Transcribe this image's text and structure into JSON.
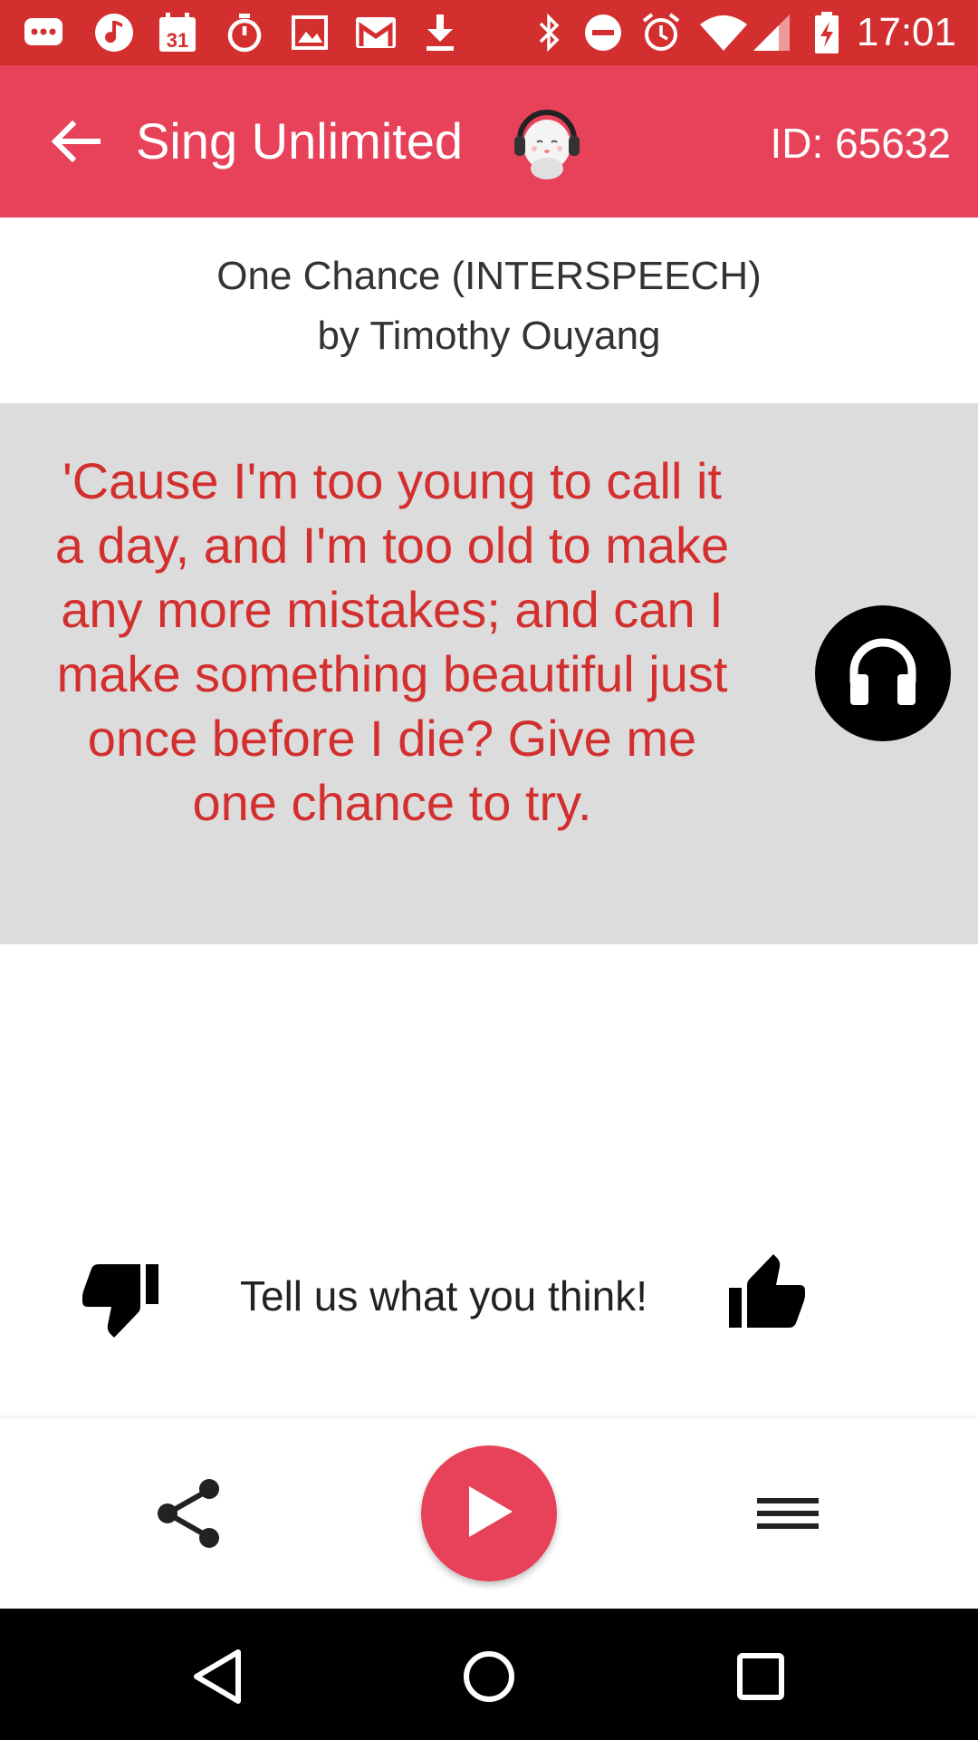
{
  "status_bar": {
    "time": "17:01",
    "calendar_day": "31",
    "icons": [
      "messages-icon",
      "music-note-icon",
      "calendar-icon",
      "stopwatch-icon",
      "image-icon",
      "gmail-icon",
      "download-icon",
      "bluetooth-icon",
      "do-not-disturb-icon",
      "alarm-icon",
      "wifi-icon",
      "signal-icon",
      "battery-charging-icon"
    ]
  },
  "app_bar": {
    "title": "Sing Unlimited",
    "song_id": "ID: 65632",
    "back_icon": "arrow-back-icon",
    "mascot_icon": "mascot-headphones-icon"
  },
  "song": {
    "title": "One Chance (INTERSPEECH)",
    "artist_line": "by Timothy Ouyang"
  },
  "lyrics": {
    "text": "'Cause I'm too young to call it a day, and I'm too old to make any more mistakes; and can I make something beautiful just once before I die? Give me one chance to try.",
    "listen_icon": "headphones-icon"
  },
  "feedback": {
    "prompt": "Tell us what you think!",
    "dislike_icon": "thumbs-down-icon",
    "like_icon": "thumbs-up-icon"
  },
  "bottom_bar": {
    "share_icon": "share-icon",
    "play_icon": "play-icon",
    "menu_icon": "menu-icon"
  },
  "nav_bar": {
    "icons": [
      "nav-back-icon",
      "nav-home-icon",
      "nav-recents-icon"
    ]
  },
  "colors": {
    "status_bar": "#d32f2f",
    "app_bar": "#e8425a",
    "lyrics_text": "#d32f2f",
    "lyrics_background": "#dcdcdc",
    "play_button": "#e8425a"
  }
}
